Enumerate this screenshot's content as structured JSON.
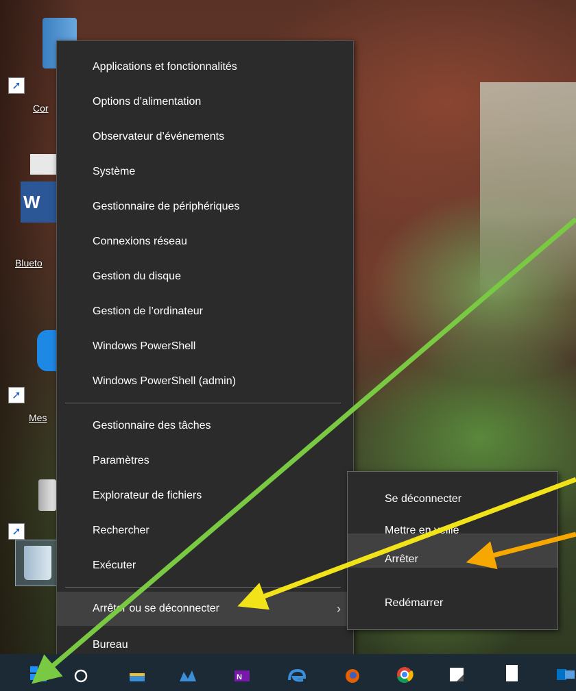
{
  "desktop": {
    "icons": [
      {
        "label": "Cor",
        "name": "control-panel-shortcut"
      },
      {
        "label": "Blueto",
        "name": "bluetooth-word-shortcut"
      },
      {
        "label": "Mes",
        "name": "messenger-shortcut"
      },
      {
        "label": "",
        "name": "speakers-shortcut"
      },
      {
        "label": "",
        "name": "recycle-bin"
      }
    ]
  },
  "menu": {
    "items": [
      {
        "label": "Applications et fonctionnalités"
      },
      {
        "label": "Options d’alimentation"
      },
      {
        "label": "Observateur d’événements"
      },
      {
        "label": "Système"
      },
      {
        "label": "Gestionnaire de périphériques"
      },
      {
        "label": "Connexions réseau"
      },
      {
        "label": "Gestion du disque"
      },
      {
        "label": "Gestion de l’ordinateur"
      },
      {
        "label": "Windows PowerShell"
      },
      {
        "label": "Windows PowerShell (admin)"
      },
      {
        "label": "Gestionnaire des tâches"
      },
      {
        "label": "Paramètres"
      },
      {
        "label": "Explorateur de fichiers"
      },
      {
        "label": "Rechercher"
      },
      {
        "label": "Exécuter"
      },
      {
        "label": "Arrêter ou se déconnecter"
      },
      {
        "label": "Bureau"
      }
    ],
    "submenu_chevron": "›"
  },
  "submenu": {
    "items": [
      {
        "label": "Se déconnecter"
      },
      {
        "label": "Mettre en veille"
      },
      {
        "label": "Arrêter"
      },
      {
        "label": "Redémarrer"
      }
    ]
  },
  "taskbar": {
    "buttons": [
      {
        "name": "start-button",
        "icon": "windows-logo-icon"
      },
      {
        "name": "cortana-button",
        "icon": "cortana-circle-icon"
      },
      {
        "name": "file-explorer-button",
        "icon": "folder-icon"
      },
      {
        "name": "app-button",
        "icon": "app-icon"
      },
      {
        "name": "onenote-button",
        "icon": "onenote-icon"
      },
      {
        "name": "edge-button",
        "icon": "edge-icon"
      },
      {
        "name": "firefox-button",
        "icon": "firefox-icon"
      },
      {
        "name": "chrome-button",
        "icon": "chrome-icon"
      },
      {
        "name": "notes-button",
        "icon": "sticky-notes-icon"
      },
      {
        "name": "document-button",
        "icon": "document-icon"
      },
      {
        "name": "outlook-button",
        "icon": "outlook-icon"
      }
    ]
  },
  "colors": {
    "menu_bg": "#2b2b2b",
    "menu_highlight": "#414141",
    "taskbar_bg": "#1c2a36",
    "arrow_green": "#7ac943",
    "arrow_yellow": "#f2e21a",
    "arrow_orange": "#f6a800"
  }
}
